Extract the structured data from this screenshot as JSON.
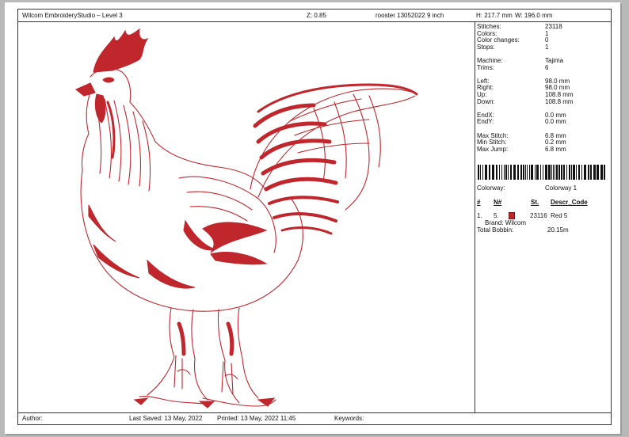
{
  "header": {
    "app_title": "Wilcom EmbroideryStudio – Level 3",
    "zoom": "Z: 0.85",
    "design_name": "rooster 13052022 9 inch",
    "height": "H: 217.7 mm",
    "width": "W: 196.0 mm"
  },
  "stats": [
    {
      "label": "Stitches:",
      "value": "23118"
    },
    {
      "label": "Colors:",
      "value": "1"
    },
    {
      "label": "Color changes:",
      "value": "0"
    },
    {
      "label": "Stops:",
      "value": "1"
    },
    {
      "label": "Machine:",
      "value": "Tajima"
    },
    {
      "label": "Trims:",
      "value": "6"
    },
    {
      "label": "Left:",
      "value": "98.0 mm"
    },
    {
      "label": "Right:",
      "value": "98.0 mm"
    },
    {
      "label": "Up:",
      "value": "108.8 mm"
    },
    {
      "label": "Down:",
      "value": "108.8 mm"
    },
    {
      "label": "EndX:",
      "value": "0.0 mm"
    },
    {
      "label": "EndY:",
      "value": "0.0 mm"
    },
    {
      "label": "Max Stitch:",
      "value": "6.8 mm"
    },
    {
      "label": "Min Stitch:",
      "value": "0.2 mm"
    },
    {
      "label": "Max Jump:",
      "value": "6.8 mm"
    }
  ],
  "colorway": {
    "label": "Colorway:",
    "value": "Colorway 1"
  },
  "color_table": {
    "headers": {
      "num": "#",
      "needle": "N#",
      "stitches": "St.",
      "descr": "Descr_Code"
    },
    "rows": [
      {
        "num": "1.",
        "needle": "5.",
        "stitches": "23116",
        "descr": "Red 5",
        "brand": "Brand: Wilcom",
        "color": "#c0272d"
      }
    ]
  },
  "bobbin": {
    "label": "Total Bobbin:",
    "value": "20.15m"
  },
  "footer": {
    "author": "Author:",
    "last_saved": "Last Saved: 13 May, 2022",
    "printed": "Printed: 13 May, 2022 11:45",
    "keywords": "Keywords:"
  },
  "design_color": "#c0272d"
}
